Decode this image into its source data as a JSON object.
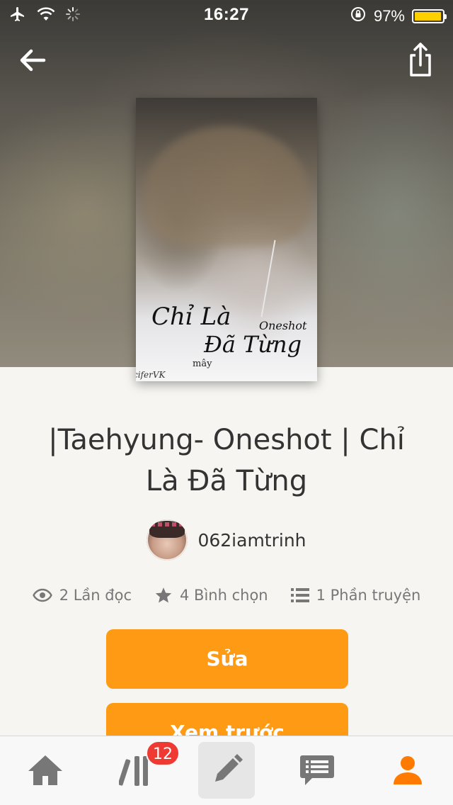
{
  "status_bar": {
    "time": "16:27",
    "battery_percent_label": "97%",
    "battery_level": 0.97,
    "battery_color": "#ffd000"
  },
  "nav": {
    "back_icon": "arrow-left-icon",
    "share_icon": "share-icon"
  },
  "cover": {
    "title_line1": "Chỉ Là",
    "title_line2": "Đã Từng",
    "subtitle": "Oneshot",
    "author_mark": "mây",
    "credit": "ciferVK"
  },
  "story": {
    "title": "|Taehyung- Oneshot | Chỉ Là Đã Từng",
    "author": "062iamtrinh",
    "stats": {
      "reads": "2 Lần đọc",
      "votes": "4 Bình chọn",
      "parts": "1 Phần truyện"
    }
  },
  "actions": {
    "edit_label": "Sửa",
    "preview_label": "Xem trước"
  },
  "tab_bar": {
    "library_badge": "12",
    "items": [
      "home-icon",
      "library-icon",
      "write-icon",
      "messages-icon",
      "profile-icon"
    ],
    "active_color": "#ff7a00",
    "inactive_color": "#777777"
  },
  "colors": {
    "accent": "#ff9a14",
    "badge": "#ee3a32"
  }
}
